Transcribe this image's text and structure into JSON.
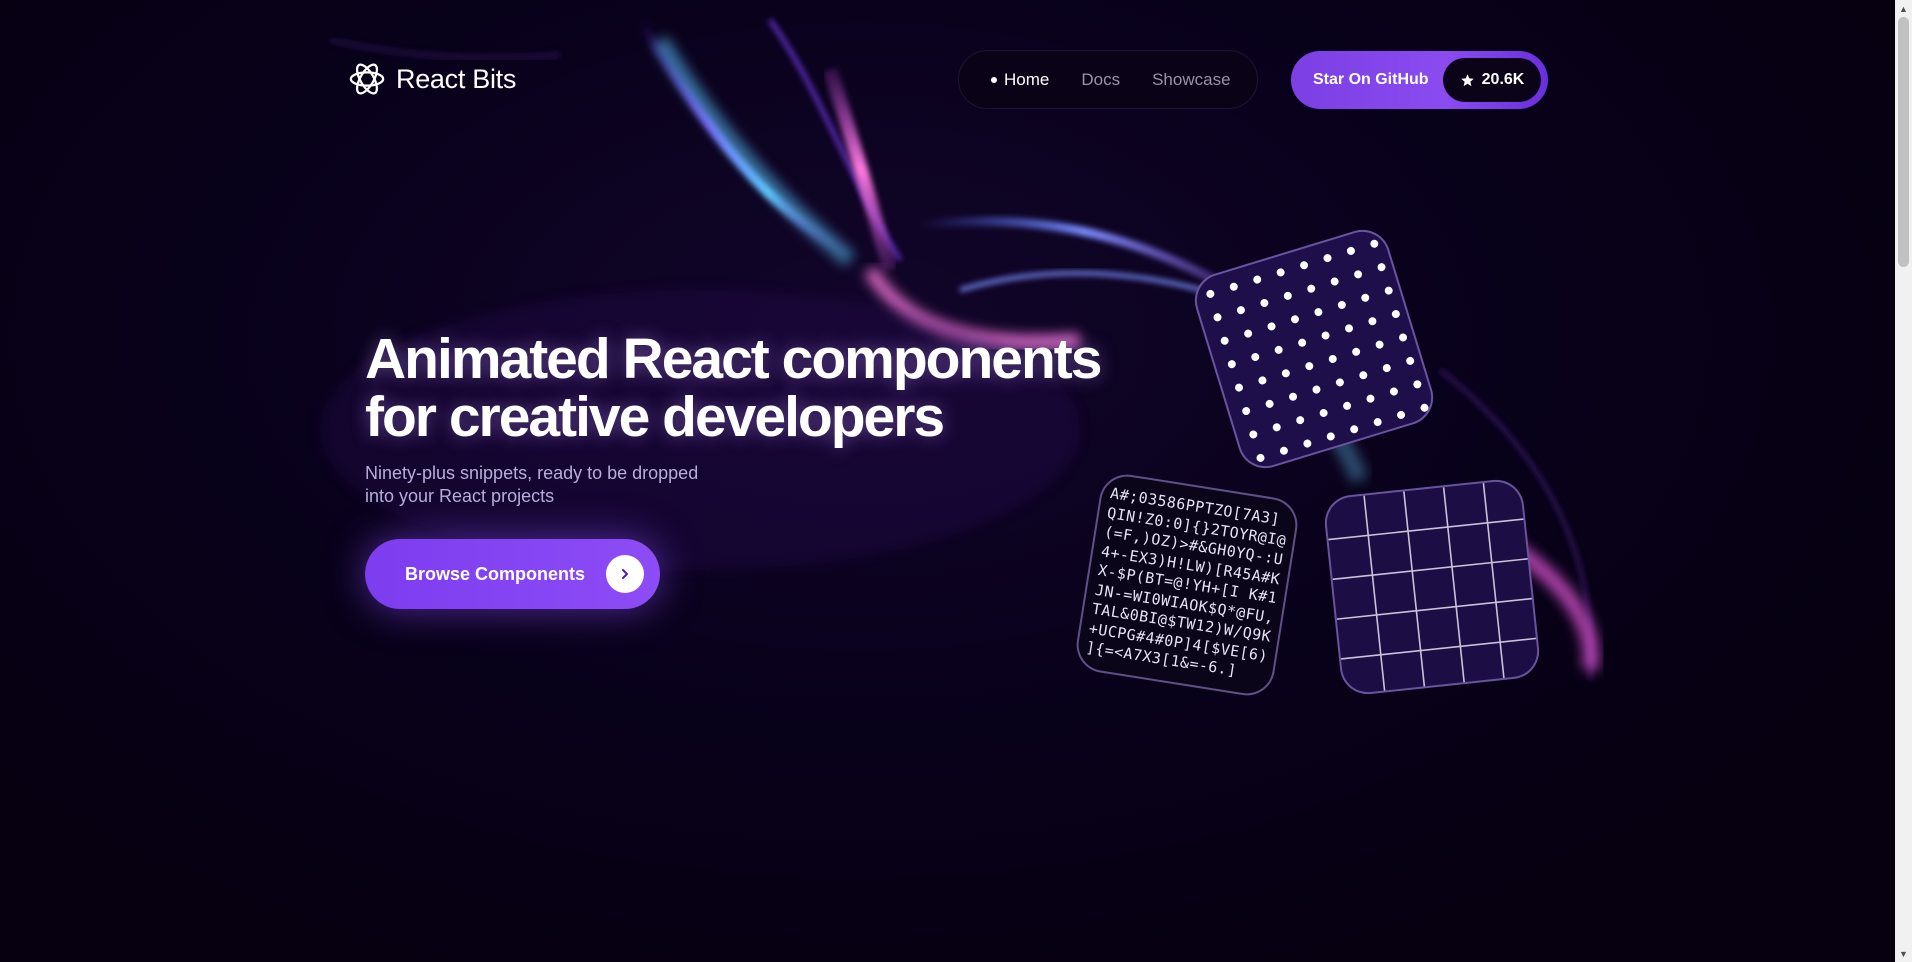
{
  "brand": {
    "name": "React Bits",
    "logo_icon": "atom-icon"
  },
  "nav": {
    "items": [
      {
        "label": "Home",
        "active": true
      },
      {
        "label": "Docs",
        "active": false
      },
      {
        "label": "Showcase",
        "active": false
      }
    ]
  },
  "github": {
    "label": "Star On GitHub",
    "stars": "20.6K",
    "icon": "star-icon"
  },
  "hero": {
    "title_line1": "Animated React components",
    "title_line2": "for creative developers",
    "subtitle_line1": "Ninety-plus snippets, ready to be dropped",
    "subtitle_line2": "into your React projects",
    "cta_label": "Browse Components",
    "cta_icon": "chevron-right-icon"
  },
  "tiles": {
    "ascii_lines": [
      "A#;03586PPTZO[7A3]",
      "QIN!Z0:0]{}2TOYR@I@",
      "(=F,)OZ)>#&GH0YQ-:U",
      "4+-EX3)H!LW)[R45A#K",
      "X-$P(BT=@!YH+[I K#1",
      "JN-=WI0WIAOK$Q*@FU,",
      "TAL&0BI@$TW12)W/Q9K",
      "+UCPG#4#0P]4[$VE[6)",
      "]{=<A7X3[1&=-6.]"
    ]
  },
  "colors": {
    "background": "#060010",
    "accent": "#7b3fe4",
    "text_muted": "#9a93a8",
    "subtitle": "#b7aedc"
  }
}
